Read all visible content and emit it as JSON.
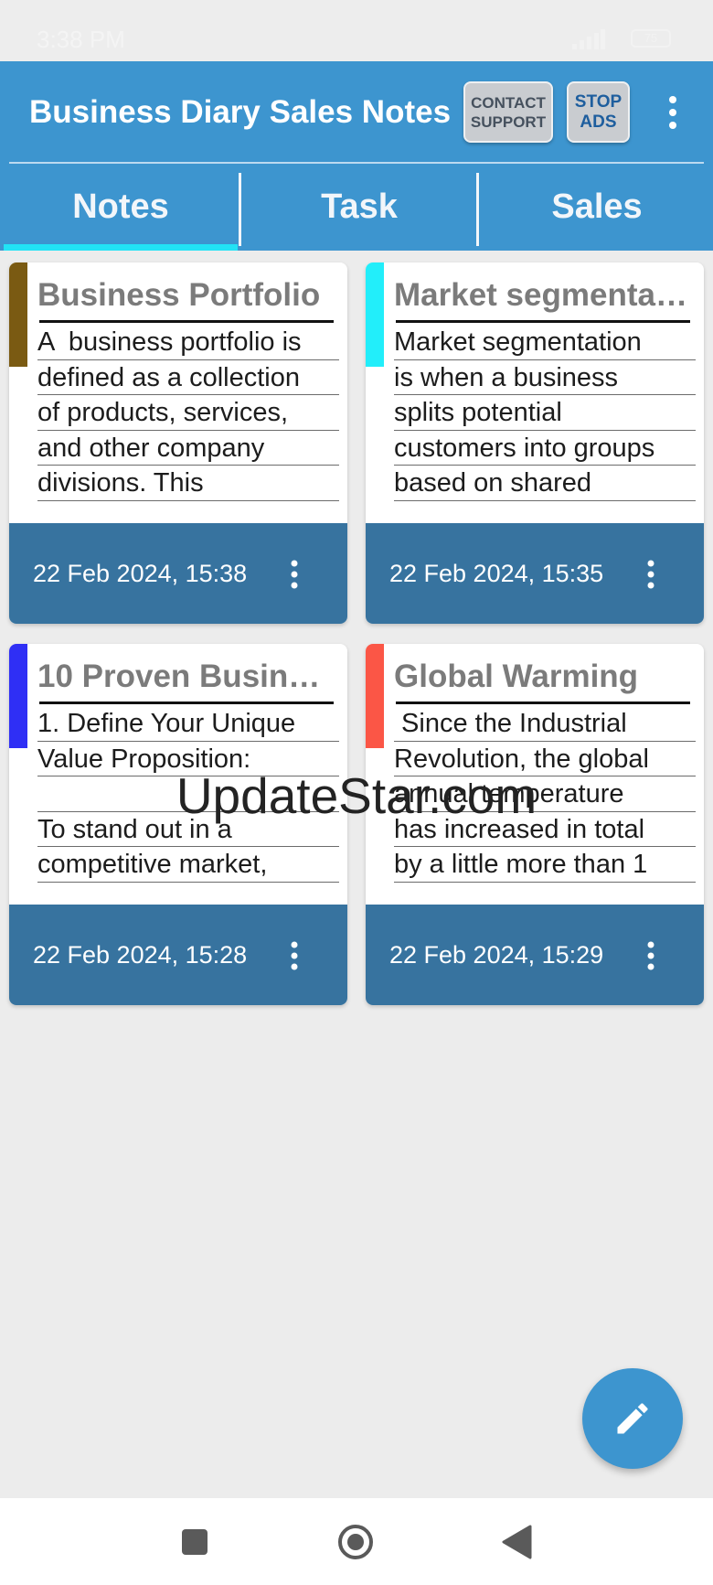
{
  "status_bar": {
    "time": "3:38 PM",
    "battery": "75"
  },
  "app_bar": {
    "title": "Business Diary Sales Notes",
    "contact_support_label": "CONTACT\nSUPPORT",
    "stop_ads_label": "STOP\nADS"
  },
  "tabs": [
    {
      "label": "Notes",
      "selected": true
    },
    {
      "label": "Task",
      "selected": false
    },
    {
      "label": "Sales",
      "selected": false
    }
  ],
  "notes": [
    {
      "title": "Business Portfolio",
      "color": "#7a5a12",
      "lines": [
        "A  business portfolio is",
        "defined as a collection",
        "of products, services,",
        "and other company",
        "divisions. This"
      ],
      "date": "22 Feb 2024, 15:38"
    },
    {
      "title": "Market segmentat…",
      "color": "#22eefa",
      "lines": [
        "Market segmentation",
        "is when a business",
        "splits potential",
        "customers into groups",
        "based on shared"
      ],
      "date": "22 Feb 2024, 15:35"
    },
    {
      "title": "10 Proven Busines…",
      "color": "#2f2ff5",
      "lines": [
        "1. Define Your Unique",
        "Value Proposition:",
        "",
        "To stand out in a",
        "competitive market,"
      ],
      "date": "22 Feb 2024, 15:28"
    },
    {
      "title": "Global Warming",
      "color": "#fb5646",
      "lines": [
        " Since the Industrial",
        "Revolution, the global",
        "annual temperature",
        "has increased in total",
        "by a little more than 1"
      ],
      "date": "22 Feb 2024, 15:29"
    }
  ],
  "watermark": "UpdateStar.com",
  "colors": {
    "app_bar": "#3d95cf",
    "card_footer": "#37739f",
    "tab_indicator": "#22e3f5",
    "fab": "#3d95cf"
  },
  "icons": {
    "fab": "pencil-icon",
    "overflow": "more-vert-icon",
    "card_menu": "more-vert-icon"
  }
}
